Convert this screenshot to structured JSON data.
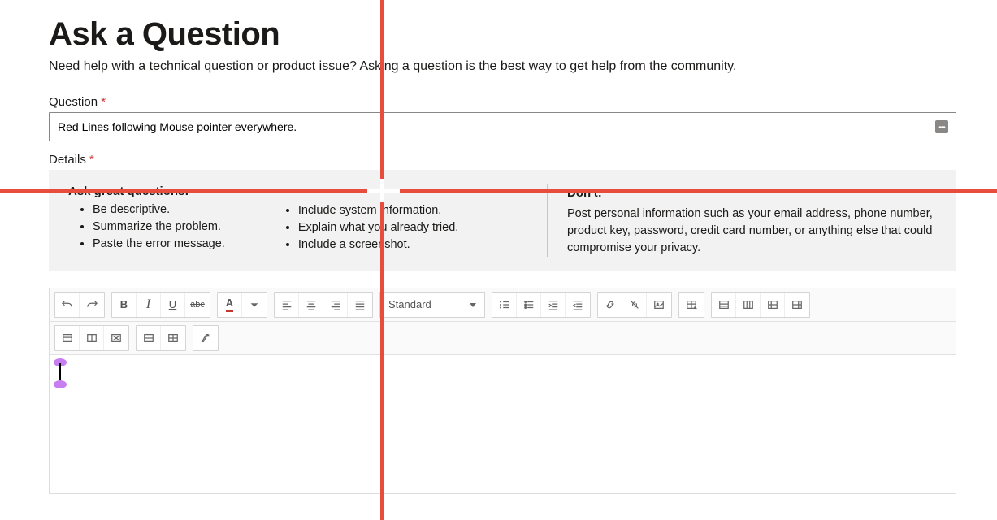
{
  "page_title": "Ask a Question",
  "subtitle": "Need help with a technical question or product issue? Asking a question is the best way to get help from the community.",
  "question": {
    "label": "Question",
    "required_mark": "*",
    "value": "Red Lines following Mouse pointer everywhere."
  },
  "details": {
    "label": "Details",
    "required_mark": "*"
  },
  "tips": {
    "ask_heading": "Ask great questions:",
    "col1": [
      "Be descriptive.",
      "Summarize the problem.",
      "Paste the error message."
    ],
    "col2": [
      "Include system information.",
      "Explain what you already tried.",
      "Include a screenshot."
    ],
    "dont_heading": "Don't:",
    "dont_text": "Post personal information such as your email address, phone number, product key, password, credit card number, or anything else that could compromise your privacy."
  },
  "toolbar": {
    "format_select": "Standard",
    "bold": "B",
    "italic": "I",
    "underline": "U",
    "strike": "abc",
    "colorA": "A"
  }
}
